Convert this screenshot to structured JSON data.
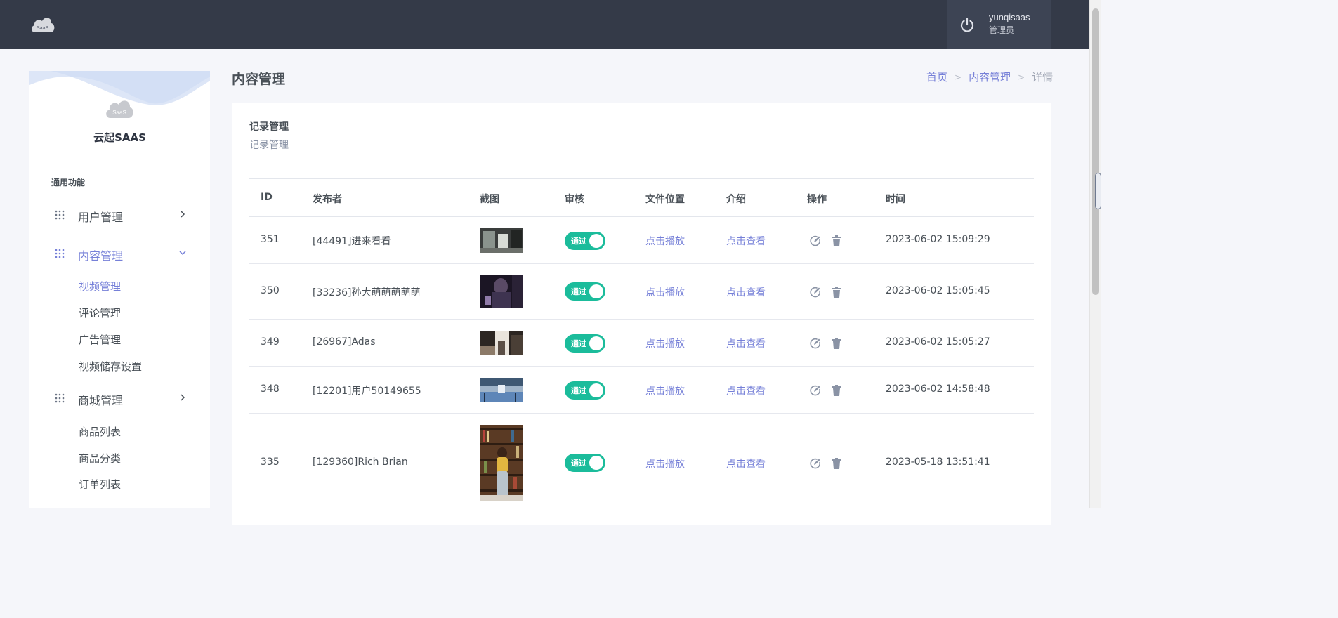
{
  "header": {
    "logo_text": "SaaS",
    "user_name": "yunqisaas",
    "user_role": "管理员"
  },
  "sidebar": {
    "logo_text": "SaaS",
    "brand": "云起SAAS",
    "section_title": "通用功能",
    "menus": [
      {
        "label": "用户管理",
        "expanded": false
      },
      {
        "label": "内容管理",
        "expanded": true,
        "children": [
          "视频管理",
          "评论管理",
          "广告管理",
          "视频储存设置"
        ]
      },
      {
        "label": "商城管理",
        "expanded": false,
        "children": [
          "商品列表",
          "商品分类",
          "订单列表"
        ]
      }
    ]
  },
  "page": {
    "title": "内容管理",
    "breadcrumb": [
      "首页",
      "内容管理",
      "详情"
    ]
  },
  "card": {
    "title": "记录管理",
    "subtitle": "记录管理"
  },
  "table": {
    "headers": [
      "ID",
      "发布者",
      "截图",
      "审核",
      "文件位置",
      "介绍",
      "操作",
      "时间"
    ],
    "rows": [
      {
        "id": "351",
        "publisher": "[44491]进来看看",
        "review": "通过",
        "file": "点击播放",
        "intro": "点击查看",
        "time": "2023-06-02 15:09:29"
      },
      {
        "id": "350",
        "publisher": "[33236]孙大萌萌萌萌萌",
        "review": "通过",
        "file": "点击播放",
        "intro": "点击查看",
        "time": "2023-06-02 15:05:45"
      },
      {
        "id": "349",
        "publisher": "[26967]Adas",
        "review": "通过",
        "file": "点击播放",
        "intro": "点击查看",
        "time": "2023-06-02 15:05:27"
      },
      {
        "id": "348",
        "publisher": "[12201]用户50149655",
        "review": "通过",
        "file": "点击播放",
        "intro": "点击查看",
        "time": "2023-06-02 14:58:48"
      },
      {
        "id": "335",
        "publisher": "[129360]Rich Brian",
        "review": "通过",
        "file": "点击播放",
        "intro": "点击查看",
        "time": "2023-05-18 13:51:41"
      }
    ]
  },
  "colors": {
    "topbar": "#343a48",
    "accent": "#7680d8",
    "switch_on": "#1bbc9b"
  }
}
